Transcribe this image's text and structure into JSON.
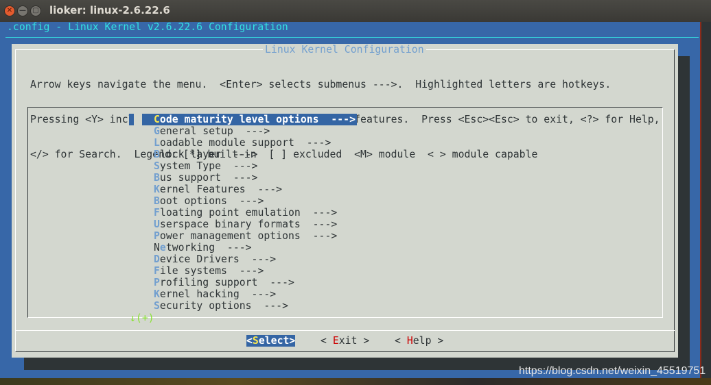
{
  "window": {
    "title": "lioker: linux-2.6.22.6"
  },
  "terminal": {
    "header": ".config - Linux Kernel v2.6.22.6 Configuration"
  },
  "dialog": {
    "title": "Linux Kernel Configuration",
    "help_lines": [
      "Arrow keys navigate the menu.  <Enter> selects submenus --->.  Highlighted letters are hotkeys.",
      "Pressing <Y> includes, <N> excludes, <M> modularizes features.  Press <Esc><Esc> to exit, <?> for Help,",
      "</> for Search.  Legend: [*] built-in  [ ] excluded  <M> module  < > module capable"
    ],
    "menu_items": [
      {
        "hotkey": "C",
        "rest": "ode maturity level options  --->",
        "selected": true
      },
      {
        "hotkey": "G",
        "rest": "eneral setup  --->"
      },
      {
        "hotkey": "L",
        "rest": "oadable module support  --->"
      },
      {
        "hotkey": "B",
        "rest": "lock layer  --->"
      },
      {
        "hotkey": "S",
        "rest": "ystem Type  --->"
      },
      {
        "hotkey": "B",
        "rest": "us support  --->"
      },
      {
        "hotkey": "K",
        "rest": "ernel Features  --->"
      },
      {
        "hotkey": "B",
        "rest": "oot options  --->"
      },
      {
        "hotkey": "F",
        "rest": "loating point emulation  --->"
      },
      {
        "hotkey": "U",
        "rest": "serspace binary formats  --->"
      },
      {
        "hotkey": "P",
        "rest": "ower management options  --->"
      },
      {
        "hotkey": "N",
        "rest": "etworking  --->",
        "hotkey_index": 1,
        "prefix": "N",
        "hk2": "e",
        "rest2": "tworking  --->"
      },
      {
        "hotkey": "D",
        "rest": "evice Drivers  --->"
      },
      {
        "hotkey": "F",
        "rest": "ile systems  --->"
      },
      {
        "hotkey": "P",
        "rest": "rofiling support  --->"
      },
      {
        "hotkey": "K",
        "rest": "ernel hacking  --->"
      },
      {
        "hotkey": "S",
        "rest": "ecurity options  --->"
      }
    ],
    "more_indicator": "↓(+)",
    "buttons": {
      "select": {
        "pre": "<",
        "hotkey": "S",
        "rest": "elect>"
      },
      "exit": {
        "pre": "< ",
        "hotkey": "E",
        "rest": "xit >"
      },
      "help": {
        "pre": "< ",
        "hotkey": "H",
        "rest": "elp >"
      }
    }
  },
  "watermark": "https://blog.csdn.net/weixin_45519751",
  "colors": {
    "terminal_bg": "#3767a8",
    "dialog_bg": "#d3d7cf",
    "highlight": "#3465a4",
    "hotkey_selected": "#fce94f",
    "header": "#34e2e2"
  }
}
